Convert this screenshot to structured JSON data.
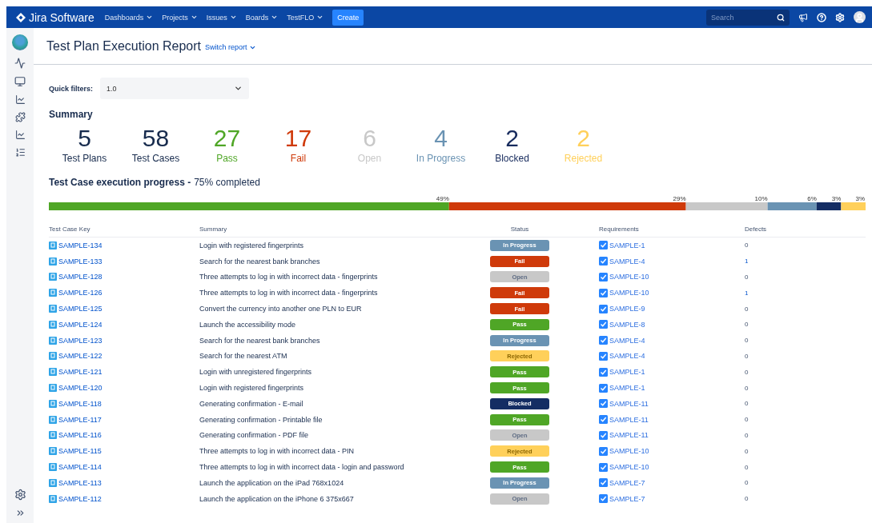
{
  "nav": {
    "product": "Jira Software",
    "menus": [
      "Dashboards",
      "Projects",
      "Issues",
      "Boards",
      "TestFLO"
    ],
    "create": "Create",
    "search": {
      "placeholder": "Search"
    }
  },
  "page": {
    "title": "Test Plan Execution Report",
    "switch": "Switch report"
  },
  "quick_filters": {
    "label": "Quick filters:",
    "value": "1.0"
  },
  "summary": {
    "title": "Summary",
    "stats": [
      {
        "value": "5",
        "label": "Test Plans",
        "color": "#172b4d"
      },
      {
        "value": "58",
        "label": "Test Cases",
        "color": "#172b4d"
      },
      {
        "value": "27",
        "label": "Pass",
        "color": "#4fa626"
      },
      {
        "value": "17",
        "label": "Fail",
        "color": "#cf3a0a"
      },
      {
        "value": "6",
        "label": "Open",
        "color": "#c8c8c8"
      },
      {
        "value": "4",
        "label": "In Progress",
        "color": "#6a93b3"
      },
      {
        "value": "2",
        "label": "Blocked",
        "color": "#172b5d"
      },
      {
        "value": "2",
        "label": "Rejected",
        "color": "#ffd05a"
      }
    ]
  },
  "progress": {
    "title": "Test Case execution progress -",
    "completed": "75% completed",
    "chart_data": {
      "type": "bar",
      "orientation": "horizontal",
      "stacked": true,
      "series": [
        {
          "color": "#4fa626",
          "values": [
            49
          ],
          "value_labels": [
            "49%"
          ]
        },
        {
          "color": "#cf3a0a",
          "values": [
            29
          ],
          "value_labels": [
            "29%"
          ]
        },
        {
          "color": "#c8c8c8",
          "values": [
            10
          ],
          "value_labels": [
            "10%"
          ]
        },
        {
          "color": "#6a93b3",
          "values": [
            6
          ],
          "value_labels": [
            "6%"
          ]
        },
        {
          "color": "#142d63",
          "values": [
            3
          ],
          "value_labels": [
            "3%"
          ]
        },
        {
          "color": "#ffd05a",
          "values": [
            3
          ],
          "value_labels": [
            "3%"
          ]
        }
      ]
    }
  },
  "table": {
    "columns": [
      "Test Case Key",
      "Summary",
      "Status",
      "Requirements",
      "Defects"
    ],
    "rows": [
      {
        "key": "SAMPLE-134",
        "summary": "Login with registered fingerprints",
        "status": {
          "kind": "in_progress",
          "label": "In Progress"
        },
        "requirement": "SAMPLE-1",
        "defects": "0",
        "defects_linked": false
      },
      {
        "key": "SAMPLE-133",
        "summary": "Search for the nearest bank branches",
        "status": {
          "kind": "fail",
          "label": "Fail"
        },
        "requirement": "SAMPLE-4",
        "defects": "1",
        "defects_linked": true
      },
      {
        "key": "SAMPLE-128",
        "summary": "Three attempts to log in with incorrect data - fingerprints",
        "status": {
          "kind": "open",
          "label": "Open"
        },
        "requirement": "SAMPLE-10",
        "defects": "0",
        "defects_linked": false
      },
      {
        "key": "SAMPLE-126",
        "summary": "Three attempts to log in with incorrect data - fingerprints",
        "status": {
          "kind": "fail",
          "label": "Fail"
        },
        "requirement": "SAMPLE-10",
        "defects": "1",
        "defects_linked": true
      },
      {
        "key": "SAMPLE-125",
        "summary": "Convert the currency into another one PLN to EUR",
        "status": {
          "kind": "fail",
          "label": "Fail"
        },
        "requirement": "SAMPLE-9",
        "defects": "0",
        "defects_linked": false
      },
      {
        "key": "SAMPLE-124",
        "summary": "Launch the accessibility mode",
        "status": {
          "kind": "pass",
          "label": "Pass"
        },
        "requirement": "SAMPLE-8",
        "defects": "0",
        "defects_linked": false
      },
      {
        "key": "SAMPLE-123",
        "summary": "Search for the nearest bank branches",
        "status": {
          "kind": "in_progress",
          "label": "In Progress"
        },
        "requirement": "SAMPLE-4",
        "defects": "0",
        "defects_linked": false
      },
      {
        "key": "SAMPLE-122",
        "summary": "Search for the nearest ATM",
        "status": {
          "kind": "rejected",
          "label": "Rejected"
        },
        "requirement": "SAMPLE-4",
        "defects": "0",
        "defects_linked": false
      },
      {
        "key": "SAMPLE-121",
        "summary": "Login with unregistered fingerprints",
        "status": {
          "kind": "pass",
          "label": "Pass"
        },
        "requirement": "SAMPLE-1",
        "defects": "0",
        "defects_linked": false
      },
      {
        "key": "SAMPLE-120",
        "summary": "Login with registered fingerprints",
        "status": {
          "kind": "pass",
          "label": "Pass"
        },
        "requirement": "SAMPLE-1",
        "defects": "0",
        "defects_linked": false
      },
      {
        "key": "SAMPLE-118",
        "summary": "Generating confirmation - E-mail",
        "status": {
          "kind": "blocked",
          "label": "Blocked"
        },
        "requirement": "SAMPLE-11",
        "defects": "0",
        "defects_linked": false
      },
      {
        "key": "SAMPLE-117",
        "summary": "Generating confirmation - Printable file",
        "status": {
          "kind": "pass",
          "label": "Pass"
        },
        "requirement": "SAMPLE-11",
        "defects": "0",
        "defects_linked": false
      },
      {
        "key": "SAMPLE-116",
        "summary": "Generating confirmation - PDF file",
        "status": {
          "kind": "open",
          "label": "Open"
        },
        "requirement": "SAMPLE-11",
        "defects": "0",
        "defects_linked": false
      },
      {
        "key": "SAMPLE-115",
        "summary": "Three attempts to log in with incorrect data - PIN",
        "status": {
          "kind": "rejected",
          "label": "Rejected"
        },
        "requirement": "SAMPLE-10",
        "defects": "0",
        "defects_linked": false
      },
      {
        "key": "SAMPLE-114",
        "summary": "Three attempts to log in with incorrect data - login and password",
        "status": {
          "kind": "pass",
          "label": "Pass"
        },
        "requirement": "SAMPLE-10",
        "defects": "0",
        "defects_linked": false
      },
      {
        "key": "SAMPLE-113",
        "summary": "Launch the application on the iPad 768x1024",
        "status": {
          "kind": "in_progress",
          "label": "In Progress"
        },
        "requirement": "SAMPLE-7",
        "defects": "0",
        "defects_linked": false
      },
      {
        "key": "SAMPLE-112",
        "summary": "Launch the application on the iPhone 6 375x667",
        "status": {
          "kind": "open",
          "label": "Open"
        },
        "requirement": "SAMPLE-7",
        "defects": "0",
        "defects_linked": false
      }
    ]
  }
}
